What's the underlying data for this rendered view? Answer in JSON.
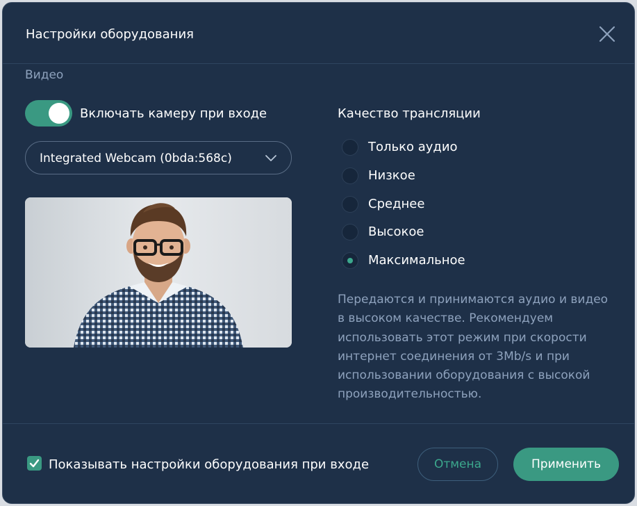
{
  "dialog": {
    "title": "Настройки оборудования"
  },
  "video": {
    "section_label": "Видео",
    "camera_toggle": {
      "label": "Включать камеру при входе",
      "on": true
    },
    "camera_select": {
      "value": "Integrated Webcam (0bda:568c)"
    }
  },
  "quality": {
    "title": "Качество трансляции",
    "options": [
      {
        "label": "Только аудио",
        "checked": false
      },
      {
        "label": "Низкое",
        "checked": false
      },
      {
        "label": "Среднее",
        "checked": false
      },
      {
        "label": "Высокое",
        "checked": false
      },
      {
        "label": "Максимальное",
        "checked": true
      }
    ],
    "description": "Передаются и принимаются аудио и видео в высоком качестве. Рекомендуем использовать этот режим при скорости интернет соединения от 3Mb/s и при использовании оборудования с высокой производительностью."
  },
  "footer": {
    "show_on_entry": {
      "label": "Показывать настройки оборудования при входе",
      "checked": true
    },
    "cancel_label": "Отмена",
    "apply_label": "Применить"
  },
  "colors": {
    "background": "#1e3048",
    "accent": "#3a9982",
    "muted_text": "#8ea2bd"
  },
  "icons": {
    "close": "close-icon",
    "dropdown": "chevron-down-icon",
    "check": "checkmark-icon"
  }
}
